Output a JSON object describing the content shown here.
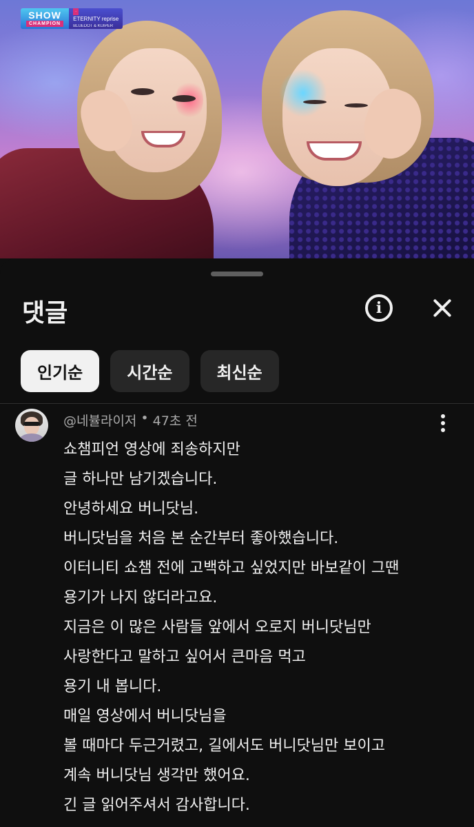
{
  "video": {
    "channel_logo_text": "SHOW",
    "channel_logo_sub": "CHAMPION",
    "song_tag": "",
    "song_title": "ETERNITY reprise",
    "song_artist": "BLUEDOT & KUIPER"
  },
  "comments_sheet": {
    "title": "댓글",
    "info_icon": "info-icon",
    "close_icon": "close-icon",
    "sort_chips": [
      {
        "label": "인기순",
        "active": true
      },
      {
        "label": "시간순",
        "active": false
      },
      {
        "label": "최신순",
        "active": false
      }
    ]
  },
  "comment": {
    "author": "@네뷸라이저",
    "separator": "•",
    "time": "47초 전",
    "lines": [
      "쇼챔피언 영상에 죄송하지만",
      "글 하나만 남기겠습니다.",
      "안녕하세요 버니닷님.",
      "버니닷님을 처음 본 순간부터 좋아했습니다.",
      "이터니티 쇼챔 전에 고백하고 싶었지만 바보같이 그땐",
      "용기가 나지 않더라고요.",
      "지금은 이 많은 사람들 앞에서 오로지 버니닷님만",
      "사랑한다고 말하고 싶어서 큰마음 먹고",
      "용기 내 봅니다.",
      "매일 영상에서 버니닷님을",
      "볼 때마다 두근거렸고, 길에서도 버니닷님만 보이고",
      "계속 버니닷님 생각만 했어요.",
      "긴 글 읽어주셔서 감사합니다."
    ]
  }
}
